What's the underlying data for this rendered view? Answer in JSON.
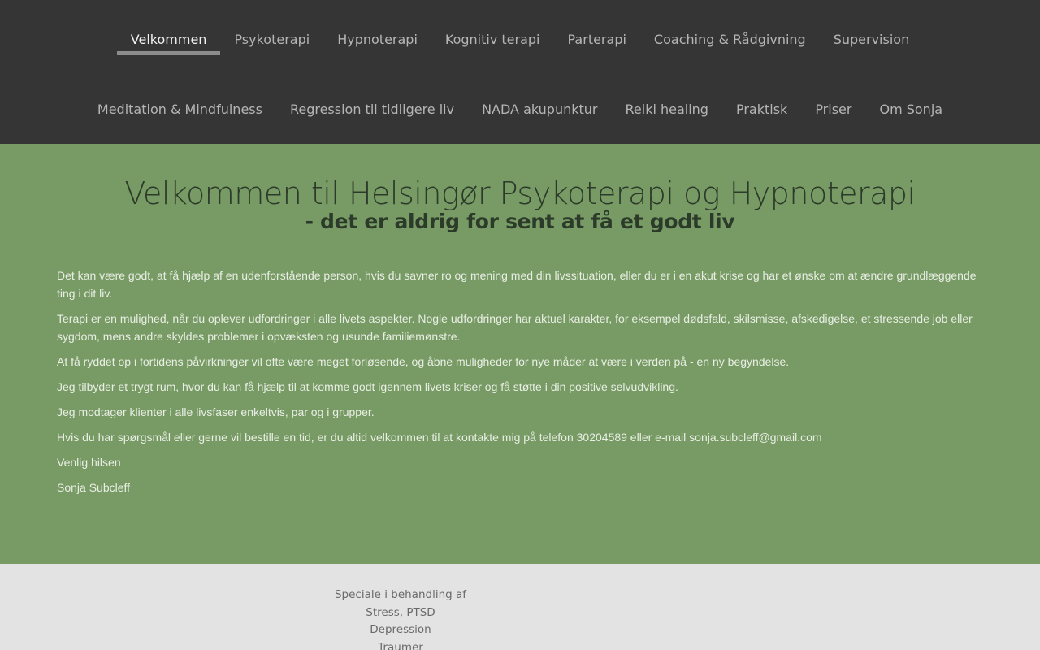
{
  "nav": {
    "row1": [
      {
        "label": "Velkommen",
        "active": true
      },
      {
        "label": "Psykoterapi"
      },
      {
        "label": "Hypnoterapi"
      },
      {
        "label": "Kognitiv terapi"
      },
      {
        "label": "Parterapi"
      },
      {
        "label": "Coaching & Rådgivning"
      },
      {
        "label": "Supervision"
      }
    ],
    "row2": [
      {
        "label": "Meditation & Mindfulness"
      },
      {
        "label": "Regression til tidligere liv"
      },
      {
        "label": "NADA akupunktur"
      },
      {
        "label": "Reiki healing"
      },
      {
        "label": "Praktisk"
      },
      {
        "label": "Priser"
      },
      {
        "label": "Om Sonja"
      }
    ]
  },
  "main": {
    "title": "Velkommen til Helsingør Psykoterapi og Hypnoterapi",
    "subtitle": "- det er aldrig for sent at få et godt liv",
    "paragraphs": [
      "Det kan være godt, at få hjælp af en udenforstående person, hvis du savner ro og mening med din livssituation, eller du er i en akut krise og har et ønske om at ændre grundlæggende ting i dit liv.",
      "Terapi er en mulighed, når du oplever udfordringer i alle livets aspekter. Nogle udfordringer har aktuel karakter, for eksempel dødsfald, skilsmisse, afskedigelse, et stressende job eller sygdom, mens andre skyldes problemer i opvæksten og usunde familiemønstre.",
      "At få ryddet op i fortidens påvirkninger vil ofte være meget forløsende, og åbne muligheder for nye måder at være i verden på - en ny begyndelse.",
      "Jeg tilbyder et trygt rum, hvor du kan få hjælp til at komme godt igennem livets kriser og få støtte i din positive selvudvikling.",
      "Jeg modtager klienter i alle livsfaser enkeltvis, par og i grupper.",
      "Hvis du har spørgsmål eller gerne vil bestille en tid, er du altid velkommen til at kontakte mig på telefon 30204589 eller e-mail sonja.subcleff@gmail.com",
      "Venlig hilsen",
      "Sonja Subcleff"
    ]
  },
  "footer": {
    "specialty_lines": [
      "Speciale i behandling af",
      "Stress, PTSD",
      "Depression",
      "Traumer"
    ]
  },
  "colors": {
    "nav_bg": "#353535",
    "main_bg": "#789b66",
    "footer_bg": "#e3e3e3",
    "active_underline": "#8c8c8c"
  }
}
